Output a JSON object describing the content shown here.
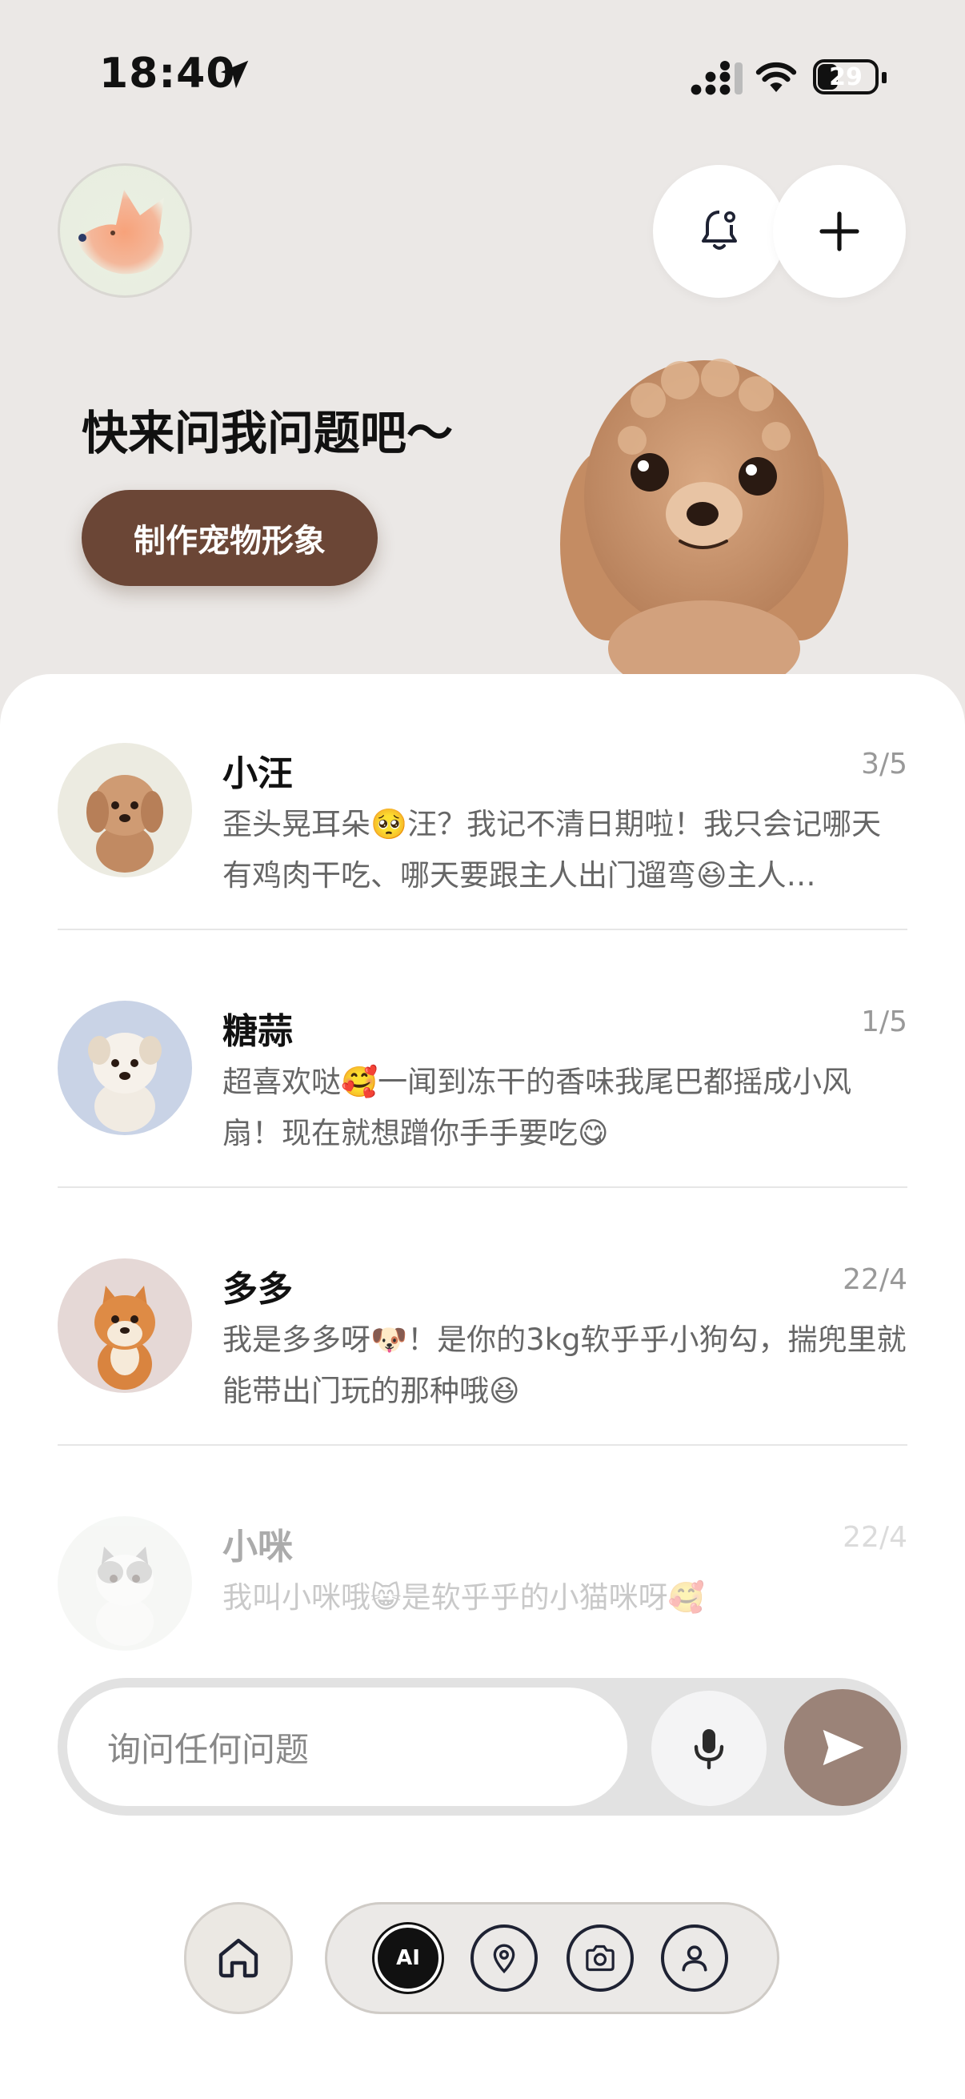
{
  "status": {
    "time": "18:40",
    "battery": "29",
    "battery_level": 0.29
  },
  "header": {
    "avatar_icon": "fox-avatar",
    "bell_icon": "bell-icon",
    "add_icon": "plus-icon"
  },
  "hero": {
    "title": "快来问我问题吧～",
    "button_label": "制作宠物形象",
    "mascot": "poodle-puppy"
  },
  "chats": [
    {
      "name": "小汪",
      "date": "3/5",
      "message": "歪头晃耳朵🥺汪？我记不清日期啦！我只会记哪天有鸡肉干吃、哪天要跟主人出门遛弯😆主人…",
      "avatar": "poodle-avatar"
    },
    {
      "name": "糖蒜",
      "date": "1/5",
      "message": "超喜欢哒🥰一闻到冻干的香味我尾巴都摇成小风扇！现在就想蹭你手手要吃😋",
      "avatar": "white-dog-avatar"
    },
    {
      "name": "多多",
      "date": "22/4",
      "message": "我是多多呀🐶！是你的3kg软乎乎小狗勾，揣兜里就能带出门玩的那种哦😆",
      "avatar": "shiba-avatar"
    },
    {
      "name": "小咪",
      "date": "22/4",
      "message": "我叫小咪哦😸是软乎乎的小猫咪呀🥰",
      "avatar": "cat-avatar"
    }
  ],
  "input": {
    "placeholder": "询问任何问题"
  },
  "tabs": {
    "ai_label": "AI"
  },
  "colors": {
    "brand_brown": "#6b4636",
    "send_button": "#9b8378",
    "background": "#ebe8e6"
  }
}
